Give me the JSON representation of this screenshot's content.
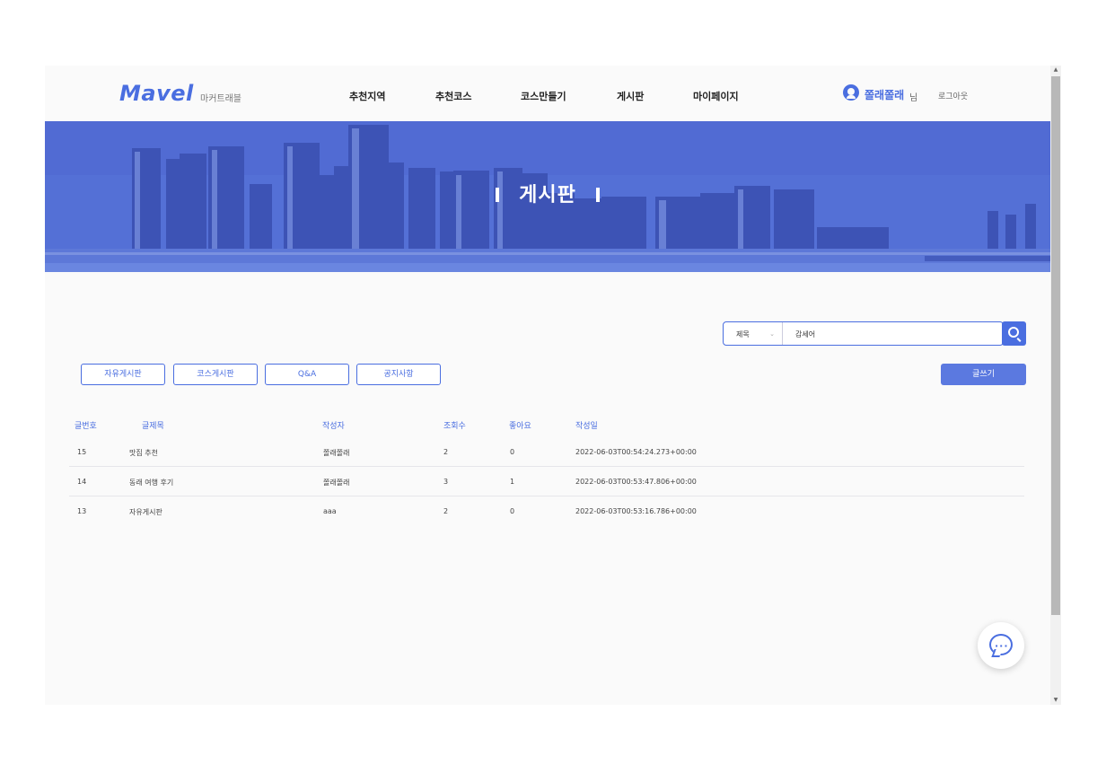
{
  "header": {
    "logo": "Mavel",
    "logo_sub": "마커트래블",
    "nav": [
      "추천지역",
      "추천코스",
      "코스만들기",
      "게시판",
      "마이페이지"
    ],
    "user_name": "쫄래쫄래",
    "user_suffix": "님",
    "logout": "로그아웃"
  },
  "banner": {
    "title": "게시판"
  },
  "search": {
    "select_value": "제목",
    "select_caret": "⌄",
    "query": "감세어"
  },
  "tabs": [
    "자유게시판",
    "코스게시판",
    "Q&A",
    "공지사항"
  ],
  "write_button": "글쓰기",
  "table": {
    "headers": [
      "글번호",
      "글제목",
      "작성자",
      "조회수",
      "좋아요",
      "작성일"
    ],
    "rows": [
      [
        "15",
        "맛집 추천",
        "쫄래쫄래",
        "2",
        "0",
        "2022-06-03T00:54:24.273+00:00"
      ],
      [
        "14",
        "동래 여행 후기",
        "쫄래쫄래",
        "3",
        "1",
        "2022-06-03T00:53:47.806+00:00"
      ],
      [
        "13",
        "자유게시판",
        "aaa",
        "2",
        "0",
        "2022-06-03T00:53:16.786+00:00"
      ]
    ]
  },
  "chat": {
    "dots": "···"
  },
  "colors": {
    "accent": "#4a6ee0",
    "banner": "#5b79db"
  }
}
